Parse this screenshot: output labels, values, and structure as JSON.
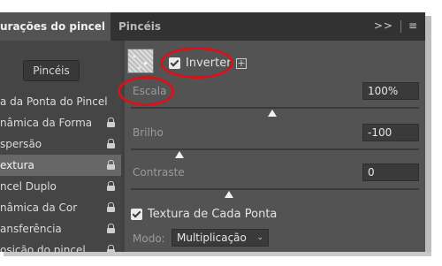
{
  "tabs": {
    "active": "urações do pincel",
    "second": "Pincéis",
    "collapse_icon": "double-chevron-right-icon",
    "menu_icon": "hamburger-menu-icon"
  },
  "left": {
    "pinceis_button": "Pincéis",
    "items": [
      {
        "label": "a da Ponta do Pincel",
        "lock": false,
        "active": false
      },
      {
        "label": "nâmica da Forma",
        "lock": true,
        "active": false
      },
      {
        "label": "spersão",
        "lock": true,
        "active": false
      },
      {
        "label": "extura",
        "lock": true,
        "active": true
      },
      {
        "label": "ncel Duplo",
        "lock": true,
        "active": false
      },
      {
        "label": "nâmica da Cor",
        "lock": true,
        "active": false
      },
      {
        "label": "ansferência",
        "lock": true,
        "active": false
      },
      {
        "label": "osição do pincel",
        "lock": true,
        "active": false
      }
    ]
  },
  "right": {
    "inverter": {
      "label": "Inverter",
      "checked": true
    },
    "escala": {
      "label": "Escala",
      "value": "100%",
      "slider": 0.49
    },
    "brilho": {
      "label": "Brilho",
      "value": "-100",
      "slider": 0.17
    },
    "contraste": {
      "label": "Contraste",
      "value": "0",
      "slider": 0.34
    },
    "textura_cada_ponta": {
      "label": "Textura de Cada Ponta",
      "checked": true
    },
    "modo": {
      "label": "Modo:",
      "value": "Multiplicação"
    }
  },
  "colors": {
    "panel": "#535353",
    "tabbar": "#323232",
    "left_column": "#454545",
    "field": "#3a3a3a",
    "annotation": "#d3141a"
  }
}
